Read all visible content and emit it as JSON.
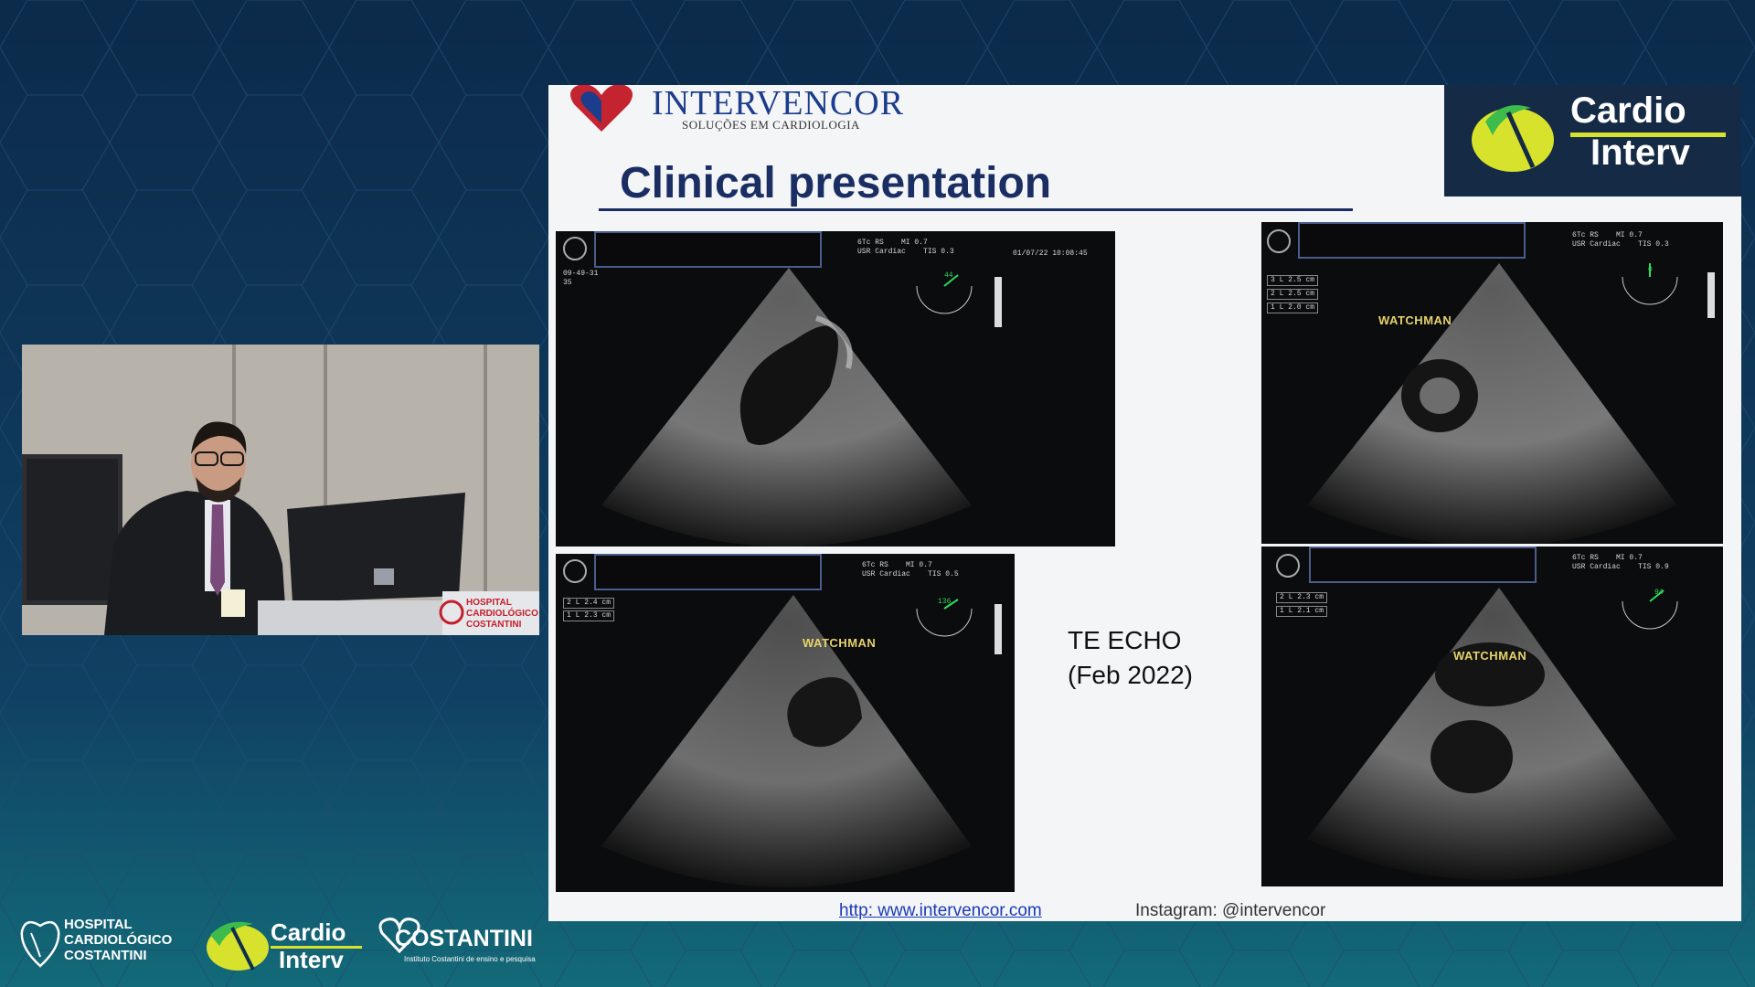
{
  "slide": {
    "company": "INTERVENCOR",
    "company_tagline": "SOLUÇÕES EM CARDIOLOGIA",
    "title": "Clinical presentation",
    "caption_line1": "TE ECHO",
    "caption_line2": "(Feb 2022)",
    "footer_url": "http: www.intervencor.com",
    "footer_instagram": "Instagram: @intervencor",
    "brand_line1": "Cardio",
    "brand_line2": "Interv"
  },
  "echos": {
    "top_left": {
      "label_left": "09-49-31\n35",
      "header": "6Tc RS    MI 0.7\nUSR Cardiac    TIS 0.3",
      "date": "01/07/22 10:08:45",
      "angle": "44"
    },
    "bottom_left": {
      "measure1": "2 L 2.4 cm",
      "measure2": "1 L 2.3 cm",
      "header": "6Tc RS    MI 0.7\nUSR Cardiac    TIS 0.5",
      "angle": "136",
      "watchman": "WATCHMAN"
    },
    "top_right": {
      "measure1": "3 L 2.5 cm",
      "measure2": "2 L 2.5 cm",
      "measure3": "1 L 2.0 cm",
      "header": "6Tc RS    MI 0.7\nUSR Cardiac    TIS 0.3",
      "angle": "0",
      "watchman": "WATCHMAN"
    },
    "bottom_right": {
      "measure1": "2 L 2.3 cm",
      "measure2": "1 L 2.1 cm",
      "header": "6Tc RS    MI 0.7\nUSR Cardiac    TIS 0.9",
      "angle": "94",
      "watchman": "WATCHMAN"
    }
  },
  "bottom_logos": {
    "hospital_line1": "HOSPITAL",
    "hospital_line2": "CARDIOLÓGICO",
    "hospital_line3": "COSTANTINI",
    "cardio_line1": "Cardio",
    "cardio_line2": "Interv",
    "costantini": "COSTANTINI",
    "costantini_sub": "Instituto Costantini de ensino e pesquisa"
  },
  "camera": {
    "podium_text_line1": "HOSPITAL",
    "podium_text_line2": "CARDIOLÓGICO",
    "podium_text_line3": "COSTANTINI"
  },
  "colors": {
    "background": "#0f2d4d",
    "slide_bg": "#f4f5f7",
    "title": "#1a2e63",
    "brand_yellow": "#d7e22c",
    "brand_green": "#3dbb4d",
    "link_blue": "#1a3ab8"
  }
}
